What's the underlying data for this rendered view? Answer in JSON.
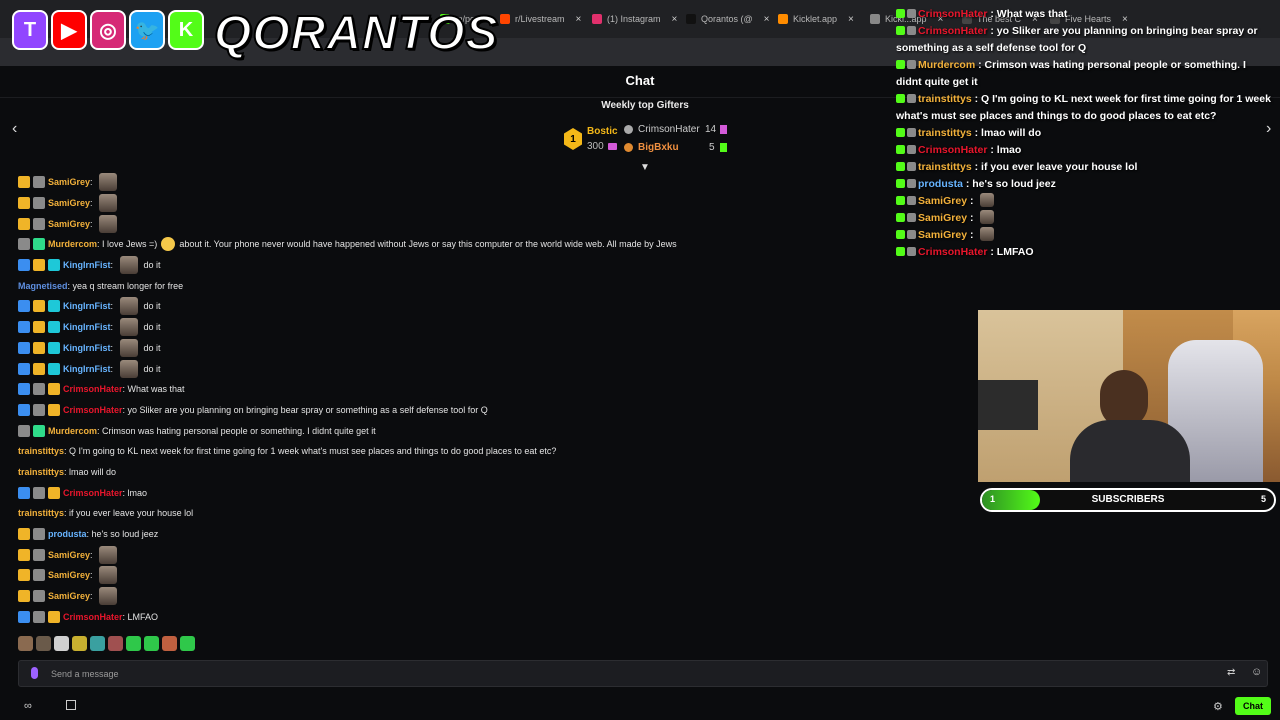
{
  "browser": {
    "tabs": [
      {
        "label": "m/po",
        "color": "#53fc18",
        "left": 0
      },
      {
        "label": "r/Livestream",
        "color": "#ff4500"
      },
      {
        "label": "(1) Instagram",
        "color": "#e1306c"
      },
      {
        "label": "Qorantos (@",
        "color": "#111111"
      },
      {
        "label": "Kicklet.app",
        "color": "#ff8c00"
      },
      {
        "label": "Kickl...app",
        "color": "#888888"
      },
      {
        "label": "The best C",
        "color": "#444444"
      },
      {
        "label": "Five Hearts",
        "color": "#444444"
      }
    ]
  },
  "overlay": {
    "brand": "QORANTOS",
    "logos": [
      {
        "name": "twitch-icon",
        "glyph": "T",
        "color": "#9146ff"
      },
      {
        "name": "youtube-icon",
        "glyph": "▶",
        "color": "#ff0000"
      },
      {
        "name": "instagram-icon",
        "glyph": "◎",
        "color": "#d62976"
      },
      {
        "name": "twitter-icon",
        "glyph": "🐦",
        "color": "#1da1f2"
      },
      {
        "name": "kick-icon",
        "glyph": "K",
        "color": "#53fc18"
      }
    ]
  },
  "chat": {
    "title": "Chat",
    "gifters_title": "Weekly top Gifters",
    "gifters": {
      "first": {
        "rank": "1",
        "name": "Bostic",
        "count": "300"
      },
      "second": {
        "name": "CrimsonHater",
        "count": "14"
      },
      "third": {
        "name": "BigBxku",
        "count": "5"
      }
    },
    "messages": [
      {
        "user": "SamiGrey",
        "color": "#f2b13b",
        "badges": [
          "#f0b428",
          "#8a8a8a"
        ],
        "text": "",
        "emote": true
      },
      {
        "user": "SamiGrey",
        "color": "#f2b13b",
        "badges": [
          "#f0b428",
          "#8a8a8a"
        ],
        "text": "",
        "emote": true
      },
      {
        "user": "SamiGrey",
        "color": "#f2b13b",
        "badges": [
          "#f0b428",
          "#8a8a8a"
        ],
        "text": "",
        "emote": true
      },
      {
        "user": "Murdercom",
        "color": "#f2b13b",
        "badges": [
          "#8a8a8a",
          "#2fdc8a"
        ],
        "text": "I love Jews =)",
        "emoji": true,
        "after": "about it. Your phone never would have happened without Jews or say this computer or the world wide web. All made by Jews"
      },
      {
        "user": "KingIrnFist",
        "color": "#67b4ff",
        "badges": [
          "#3b8ef0",
          "#f0b428",
          "#1ec8d8"
        ],
        "text": "do it",
        "emote": true
      },
      {
        "user": "Magnetised",
        "color": "#5e8fe0",
        "badges": [],
        "text": "yea q stream longer for free"
      },
      {
        "user": "KingIrnFist",
        "color": "#67b4ff",
        "badges": [
          "#3b8ef0",
          "#f0b428",
          "#1ec8d8"
        ],
        "text": "do it",
        "emote": true
      },
      {
        "user": "KingIrnFist",
        "color": "#67b4ff",
        "badges": [
          "#3b8ef0",
          "#f0b428",
          "#1ec8d8"
        ],
        "text": "do it",
        "emote": true
      },
      {
        "user": "KingIrnFist",
        "color": "#67b4ff",
        "badges": [
          "#3b8ef0",
          "#f0b428",
          "#1ec8d8"
        ],
        "text": "do it",
        "emote": true
      },
      {
        "user": "KingIrnFist",
        "color": "#67b4ff",
        "badges": [
          "#3b8ef0",
          "#f0b428",
          "#1ec8d8"
        ],
        "text": "do it",
        "emote": true
      },
      {
        "user": "CrimsonHater",
        "color": "#e8162c",
        "badges": [
          "#3b8ef0",
          "#8a8a8a",
          "#f0b428"
        ],
        "text": "What was that"
      },
      {
        "user": "CrimsonHater",
        "color": "#e8162c",
        "badges": [
          "#3b8ef0",
          "#8a8a8a",
          "#f0b428"
        ],
        "text": "yo Sliker are you planning on bringing bear spray or something as a self defense tool for Q"
      },
      {
        "user": "Murdercom",
        "color": "#f2b13b",
        "badges": [
          "#8a8a8a",
          "#2fdc8a"
        ],
        "text": "Crimson was hating personal people or something. I didnt quite get it"
      },
      {
        "user": "trainstittys",
        "color": "#f2b13b",
        "badges": [],
        "text": "Q I'm going to KL next week for first time going for 1 week what's must see places and things to do good places to eat etc?"
      },
      {
        "user": "trainstittys",
        "color": "#f2b13b",
        "badges": [],
        "text": "lmao will do"
      },
      {
        "user": "CrimsonHater",
        "color": "#e8162c",
        "badges": [
          "#3b8ef0",
          "#8a8a8a",
          "#f0b428"
        ],
        "text": "lmao"
      },
      {
        "user": "trainstittys",
        "color": "#f2b13b",
        "badges": [],
        "text": "if you ever leave your house lol"
      },
      {
        "user": "produsta",
        "color": "#67b4ff",
        "badges": [
          "#f0b428",
          "#8a8a8a"
        ],
        "text": "he's so loud jeez"
      },
      {
        "user": "SamiGrey",
        "color": "#f2b13b",
        "badges": [
          "#f0b428",
          "#8a8a8a"
        ],
        "text": "",
        "emote": true
      },
      {
        "user": "SamiGrey",
        "color": "#f2b13b",
        "badges": [
          "#f0b428",
          "#8a8a8a"
        ],
        "text": "",
        "emote": true
      },
      {
        "user": "SamiGrey",
        "color": "#f2b13b",
        "badges": [
          "#f0b428",
          "#8a8a8a"
        ],
        "text": "",
        "emote": true
      },
      {
        "user": "CrimsonHater",
        "color": "#e8162c",
        "badges": [
          "#3b8ef0",
          "#8a8a8a",
          "#f0b428"
        ],
        "text": "LMFAO"
      }
    ],
    "input_placeholder": "Send a message",
    "send_label": "Chat"
  },
  "overlay_chat": [
    {
      "user": "CrimsonHater",
      "color": "#e8162c",
      "text": "What was that"
    },
    {
      "user": "CrimsonHater",
      "color": "#e8162c",
      "text": "yo Sliker are you planning on bringing bear spray or something as a self defense tool for Q"
    },
    {
      "user": "Murdercom",
      "color": "#f2b13b",
      "text": "Crimson was hating personal people or something. I didnt quite get it"
    },
    {
      "user": "trainstittys",
      "color": "#f2b13b",
      "text": "Q I'm going to KL next week for first time going for 1 week what's must see places and things to do good places to eat etc?"
    },
    {
      "user": "trainstittys",
      "color": "#f2b13b",
      "text": "lmao will do"
    },
    {
      "user": "CrimsonHater",
      "color": "#e8162c",
      "text": "lmao"
    },
    {
      "user": "trainstittys",
      "color": "#f2b13b",
      "text": "if you ever leave your house lol"
    },
    {
      "user": "produsta",
      "color": "#67b4ff",
      "text": "he's so loud jeez"
    },
    {
      "user": "SamiGrey",
      "color": "#f2b13b",
      "text": ""
    },
    {
      "user": "SamiGrey",
      "color": "#f2b13b",
      "text": ""
    },
    {
      "user": "SamiGrey",
      "color": "#f2b13b",
      "text": ""
    },
    {
      "user": "CrimsonHater",
      "color": "#e8162c",
      "text": "LMFAO"
    }
  ],
  "sub_goal": {
    "label": "SUBSCRIBERS",
    "current": "1",
    "target": "5",
    "progress": 0.2
  },
  "colors": {
    "accent": "#53fc18",
    "gold": "#f4b818"
  },
  "emote_bar_colors": [
    "#8a6a50",
    "#6a5a4a",
    "#d0d0d0",
    "#c8b030",
    "#3aa0a0",
    "#a05050",
    "#2fc84a",
    "#2fc84a",
    "#c06040",
    "#2fc84a"
  ]
}
